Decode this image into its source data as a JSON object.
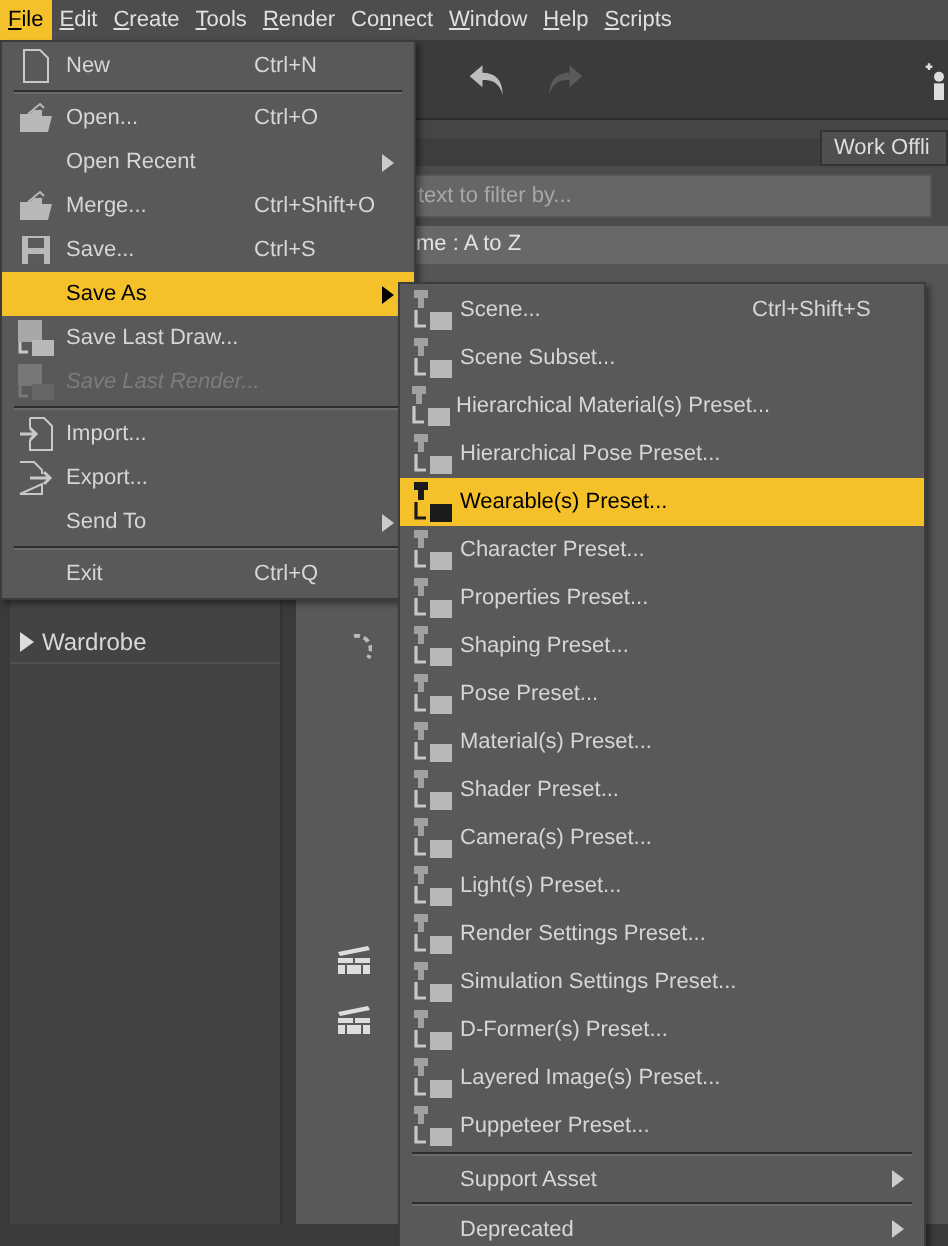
{
  "menubar": [
    {
      "key": "F",
      "post": "ile",
      "selected": true
    },
    {
      "key": "E",
      "post": "dit",
      "selected": false
    },
    {
      "key": "C",
      "post": "reate",
      "selected": false
    },
    {
      "key": "T",
      "post": "ools",
      "selected": false
    },
    {
      "key": "R",
      "post": "ender",
      "selected": false
    },
    {
      "pre": "Co",
      "key": "n",
      "post": "nect",
      "selected": false
    },
    {
      "key": "W",
      "post": "indow",
      "selected": false
    },
    {
      "key": "H",
      "post": "elp",
      "selected": false
    },
    {
      "key": "S",
      "post": "cripts",
      "selected": false
    }
  ],
  "panel": {
    "tab": "Work Offli",
    "filter_placeholder": "text to filter by...",
    "sort": "me : A to Z",
    "tree": [
      {
        "label": "Wardrobe",
        "expanded": false
      }
    ]
  },
  "file_menu": [
    {
      "kind": "item",
      "label": "New",
      "shortcut": "Ctrl+N",
      "submenu": false,
      "disabled": false,
      "selected": false
    },
    {
      "kind": "separator"
    },
    {
      "kind": "item",
      "label": "Open...",
      "shortcut": "Ctrl+O",
      "submenu": false,
      "disabled": false,
      "selected": false
    },
    {
      "kind": "item",
      "label": "Open Recent",
      "submenu": true,
      "disabled": false,
      "selected": false
    },
    {
      "kind": "item",
      "label": "Merge...",
      "shortcut": "Ctrl+Shift+O",
      "submenu": false,
      "disabled": false,
      "selected": false
    },
    {
      "kind": "item",
      "label": "Save...",
      "shortcut": "Ctrl+S",
      "submenu": false,
      "disabled": false,
      "selected": false
    },
    {
      "kind": "item",
      "label": "Save As",
      "submenu": true,
      "disabled": false,
      "selected": true
    },
    {
      "kind": "item",
      "label": "Save Last Draw...",
      "submenu": false,
      "disabled": false,
      "selected": false
    },
    {
      "kind": "item",
      "label": "Save Last Render...",
      "submenu": false,
      "disabled": true,
      "selected": false
    },
    {
      "kind": "separator"
    },
    {
      "kind": "item",
      "label": "Import...",
      "submenu": false,
      "disabled": false,
      "selected": false
    },
    {
      "kind": "item",
      "label": "Export...",
      "submenu": false,
      "disabled": false,
      "selected": false
    },
    {
      "kind": "item",
      "label": "Send To",
      "submenu": true,
      "disabled": false,
      "selected": false
    },
    {
      "kind": "separator"
    },
    {
      "kind": "item",
      "label": "Exit",
      "shortcut": "Ctrl+Q",
      "submenu": false,
      "disabled": false,
      "selected": false
    }
  ],
  "save_as_menu": [
    {
      "kind": "item",
      "label": "Scene...",
      "shortcut": "Ctrl+Shift+S",
      "submenu": false,
      "selected": false
    },
    {
      "kind": "item",
      "label": "Scene Subset...",
      "submenu": false,
      "selected": false
    },
    {
      "kind": "item",
      "label": "Hierarchical Material(s) Preset...",
      "submenu": false,
      "selected": false
    },
    {
      "kind": "item",
      "label": "Hierarchical Pose Preset...",
      "submenu": false,
      "selected": false
    },
    {
      "kind": "item",
      "label": "Wearable(s) Preset...",
      "submenu": false,
      "selected": true
    },
    {
      "kind": "item",
      "label": "Character Preset...",
      "submenu": false,
      "selected": false
    },
    {
      "kind": "item",
      "label": "Properties Preset...",
      "submenu": false,
      "selected": false
    },
    {
      "kind": "item",
      "label": "Shaping Preset...",
      "submenu": false,
      "selected": false
    },
    {
      "kind": "item",
      "label": "Pose Preset...",
      "submenu": false,
      "selected": false
    },
    {
      "kind": "item",
      "label": "Material(s) Preset...",
      "submenu": false,
      "selected": false
    },
    {
      "kind": "item",
      "label": "Shader Preset...",
      "submenu": false,
      "selected": false
    },
    {
      "kind": "item",
      "label": "Camera(s) Preset...",
      "submenu": false,
      "selected": false
    },
    {
      "kind": "item",
      "label": "Light(s) Preset...",
      "submenu": false,
      "selected": false
    },
    {
      "kind": "item",
      "label": "Render Settings Preset...",
      "submenu": false,
      "selected": false
    },
    {
      "kind": "item",
      "label": "Simulation Settings Preset...",
      "submenu": false,
      "selected": false
    },
    {
      "kind": "item",
      "label": "D-Former(s) Preset...",
      "submenu": false,
      "selected": false
    },
    {
      "kind": "item",
      "label": "Layered Image(s) Preset...",
      "submenu": false,
      "selected": false
    },
    {
      "kind": "item",
      "label": "Puppeteer Preset...",
      "submenu": false,
      "selected": false
    },
    {
      "kind": "separator"
    },
    {
      "kind": "item",
      "label": "Support Asset",
      "submenu": true,
      "selected": false
    },
    {
      "kind": "separator"
    },
    {
      "kind": "item",
      "label": "Deprecated",
      "submenu": true,
      "selected": false
    }
  ]
}
